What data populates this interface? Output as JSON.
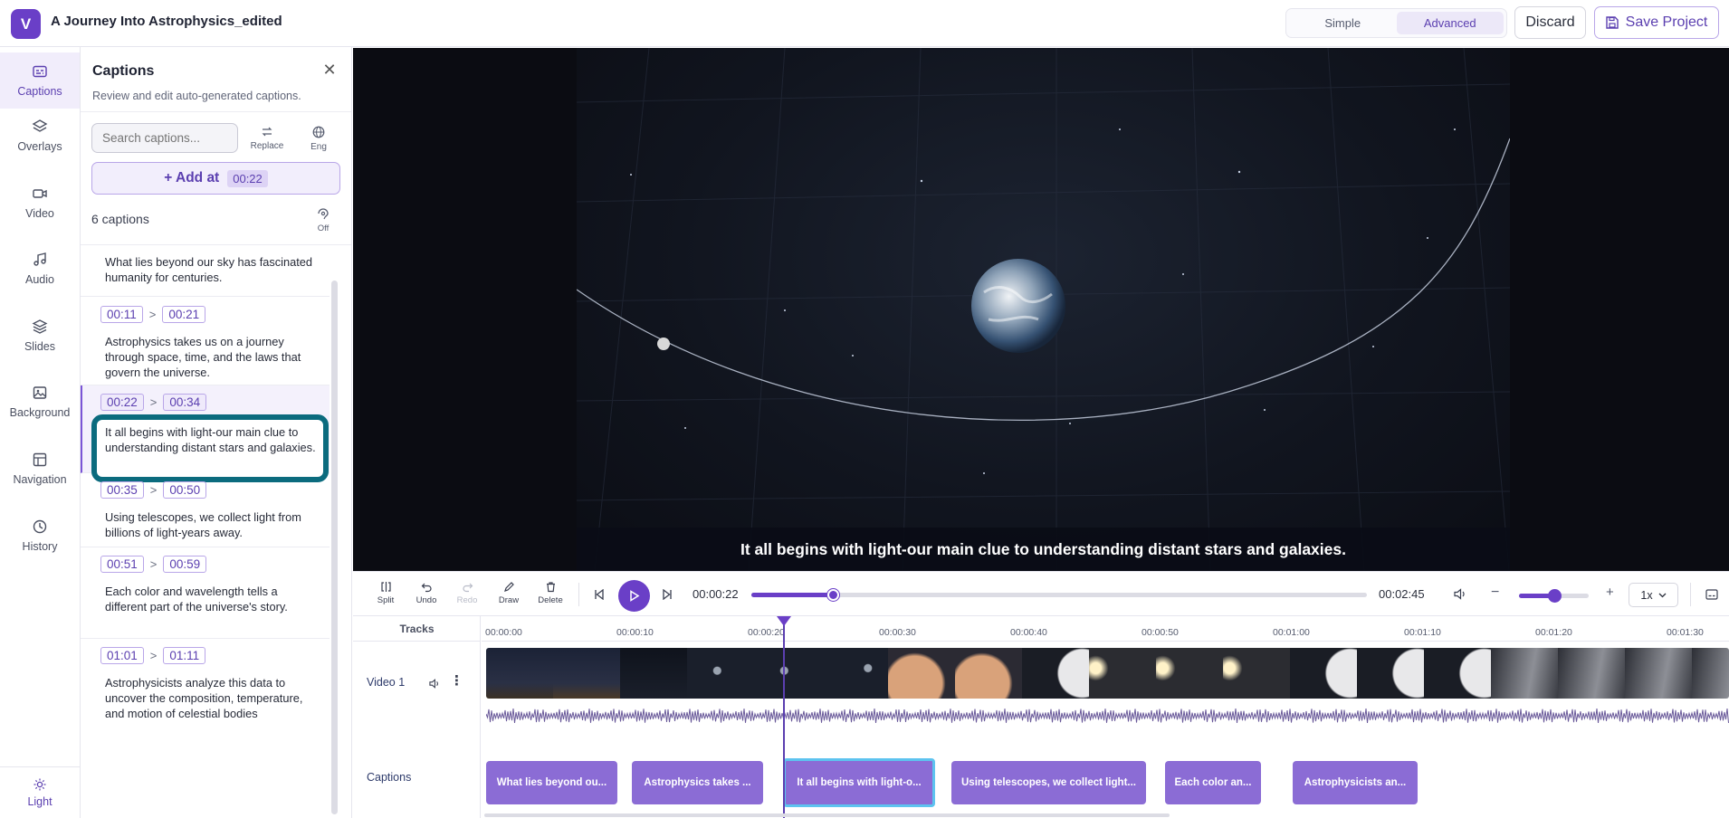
{
  "app": {
    "logo_letter": "V",
    "project_title": "A Journey Into Astrophysics_edited",
    "accent": "#6a3fc7"
  },
  "header": {
    "mode_options": [
      "Simple",
      "Advanced"
    ],
    "mode_selected": "Advanced",
    "discard_label": "Discard",
    "save_label": "Save Project"
  },
  "sidebar": {
    "items": [
      {
        "label": "Captions",
        "icon": "captions-icon",
        "active": true
      },
      {
        "label": "Overlays",
        "icon": "layers-icon"
      },
      {
        "label": "Video",
        "icon": "video-camera-icon"
      },
      {
        "label": "Audio",
        "icon": "music-note-icon"
      },
      {
        "label": "Slides",
        "icon": "stack-icon"
      },
      {
        "label": "Background",
        "icon": "image-icon"
      },
      {
        "label": "Navigation",
        "icon": "layout-icon"
      },
      {
        "label": "History",
        "icon": "history-icon"
      }
    ],
    "theme_label": "Light"
  },
  "panel": {
    "title": "Captions",
    "subtitle": "Review and edit auto-generated captions.",
    "search_placeholder": "Search captions...",
    "replace_label": "Replace",
    "lang_label": "Eng",
    "add_label": "+ Add at",
    "add_time": "00:22",
    "count_label": "6 captions",
    "off_label": "Off",
    "separator": ">",
    "entries": [
      {
        "start": "",
        "end": "",
        "text": "What lies beyond our sky has fascinated humanity for centuries."
      },
      {
        "start": "00:11",
        "end": "00:21",
        "text": "Astrophysics takes us on a journey through space, time, and the laws that govern the universe."
      },
      {
        "start": "00:22",
        "end": "00:34",
        "text": "It all begins with light-our main clue to understanding distant stars and galaxies.",
        "active": true
      },
      {
        "start": "00:35",
        "end": "00:50",
        "text": "Using telescopes, we collect light from billions of light-years away."
      },
      {
        "start": "00:51",
        "end": "00:59",
        "text": "Each color and wavelength tells a different part of the universe's story."
      },
      {
        "start": "01:01",
        "end": "01:11",
        "text": "Astrophysicists analyze this data to uncover the composition, temperature, and motion of celestial bodies"
      }
    ]
  },
  "player": {
    "subtitle": "It all begins with light-our main clue to understanding distant stars and galaxies.",
    "current_time": "00:00:22",
    "duration": "00:02:45",
    "progress_fraction": 0.133,
    "volume_fraction": 0.5,
    "speed": "1x",
    "tools": [
      {
        "label": "Split",
        "icon": "split-icon"
      },
      {
        "label": "Undo",
        "icon": "undo-icon"
      },
      {
        "label": "Redo",
        "icon": "redo-icon",
        "disabled": true
      },
      {
        "label": "Draw",
        "icon": "pencil-icon"
      },
      {
        "label": "Delete",
        "icon": "trash-icon"
      }
    ]
  },
  "timeline": {
    "tracks_label": "Tracks",
    "video_track_label": "Video 1",
    "captions_track_label": "Captions",
    "ticks": [
      "00:00:00",
      "00:00:10",
      "00:00:20",
      "00:00:30",
      "00:00:40",
      "00:00:50",
      "00:01:00",
      "00:01:10",
      "00:01:20",
      "00:01:30"
    ],
    "caption_clips": [
      {
        "label": "What lies beyond ou..."
      },
      {
        "label": "Astrophysics takes ..."
      },
      {
        "label": "It all begins with light-o...",
        "selected": true
      },
      {
        "label": "Using telescopes, we collect light..."
      },
      {
        "label": "Each color an..."
      },
      {
        "label": "Astrophysicists an..."
      }
    ]
  }
}
